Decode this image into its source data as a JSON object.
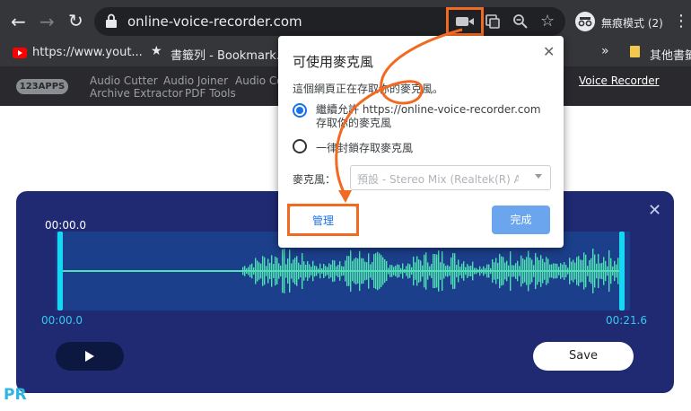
{
  "browser": {
    "url": "online-voice-recorder.com",
    "profile_label": "無痕模式 (2)",
    "bookmarks": [
      "https://www.yout...",
      "書籤列 - Bookmark...",
      "其他書籤"
    ],
    "overflow": "»"
  },
  "site": {
    "logo": "123APPS",
    "nav_row1": [
      "Audio Cutter",
      "Audio Joiner",
      "Audio Co"
    ],
    "nav_row2": [
      "Archive Extractor",
      "PDF Tools"
    ],
    "active_tool": "Voice Recorder"
  },
  "recorder": {
    "time_top": "00:00.0",
    "time_start": "00:00.0",
    "time_end": "00:21.6",
    "save_label": "Save",
    "wave_color": "#4fe0b6"
  },
  "popup": {
    "title": "可使用麥克風",
    "subtitle": "這個網頁正在存取你的麥克風。",
    "option_allow": "繼續允許 https://online-voice-recorder.com 存取你的麥克風",
    "option_block": "一律封鎖存取麥克風",
    "mic_label": "麥克風：",
    "mic_value": "預設 - Stereo Mix (Realtek(R) A...",
    "manage_label": "管理",
    "done_label": "完成"
  },
  "watermark": "PR"
}
